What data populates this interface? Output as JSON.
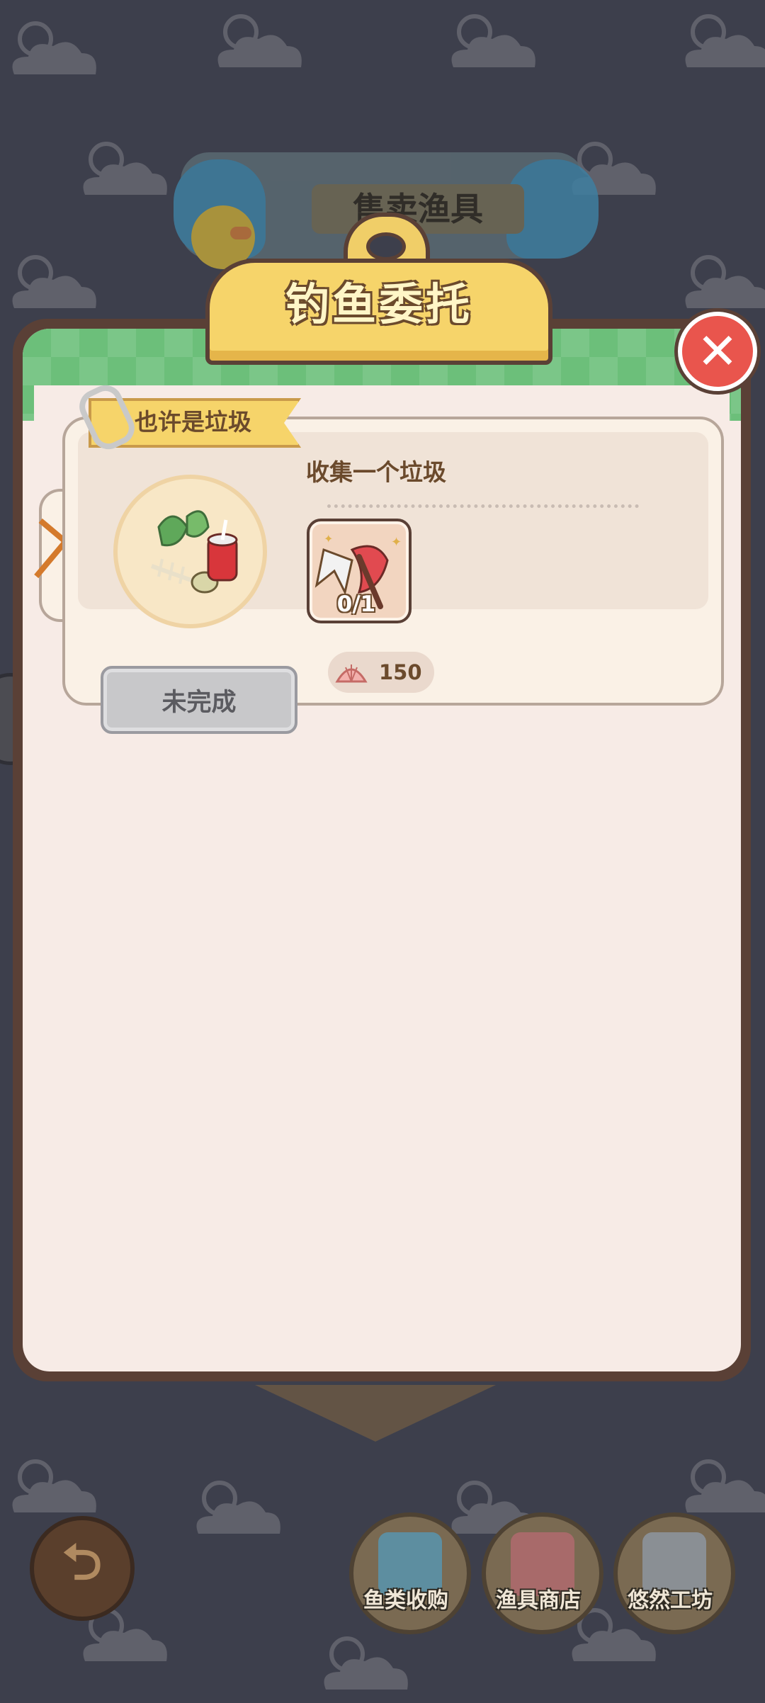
{
  "background": {
    "color": "#3d3f4c",
    "banner_title": "售卖渔具"
  },
  "modal": {
    "title": "钓鱼委托",
    "close_icon": "close-x-icon"
  },
  "task": {
    "tag_label": "也许是垃圾",
    "description": "收集一个垃圾",
    "item_progress": "0/1",
    "reward_amount": "150",
    "status_label": "未完成"
  },
  "bottom_nav": {
    "items": [
      {
        "label": "鱼类收购"
      },
      {
        "label": "渔具商店"
      },
      {
        "label": "悠然工坊"
      }
    ]
  },
  "colors": {
    "accent_green": "#6cbf7a",
    "plaque_yellow": "#f6d46a",
    "close_red": "#e9554d",
    "frame_brown": "#5a4036"
  }
}
